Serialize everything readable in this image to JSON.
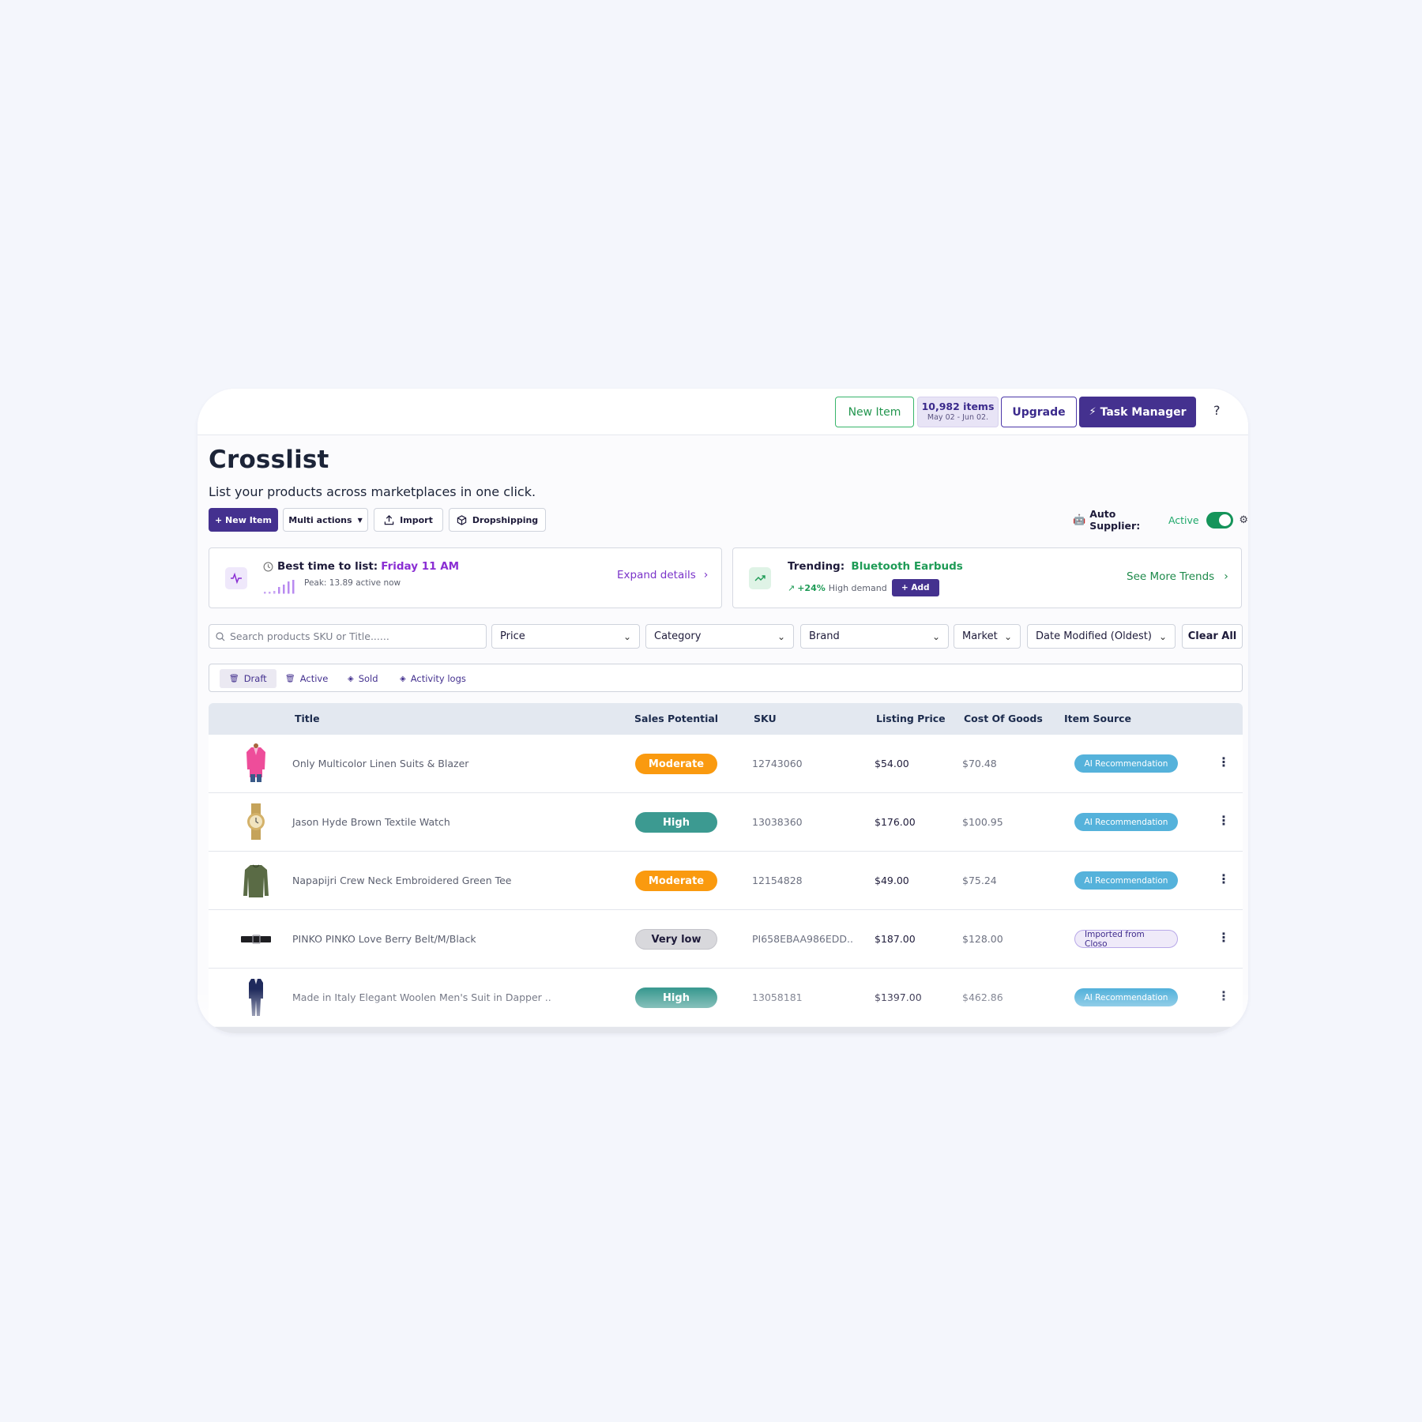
{
  "topbar": {
    "new_item": "New Item",
    "items_count": "10,982 items",
    "items_range": "May 02 - Jun 02.",
    "upgrade": "Upgrade",
    "task_manager": "Task Manager",
    "help": "?"
  },
  "page": {
    "title": "Crosslist",
    "subtitle": "List your products across marketplaces in one click."
  },
  "actions": {
    "new_item": "+ New Item",
    "multi_actions": "Multi actions",
    "import": "Import",
    "dropshipping": "Dropshipping"
  },
  "auto_supplier": {
    "label": "Auto Supplier:",
    "status": "Active",
    "enabled": true
  },
  "insights": {
    "best_time_label": "Best time to list:",
    "best_time_value": "Friday 11 AM",
    "peak": "Peak: 13.89 active now",
    "expand": "Expand details",
    "trending_label": "Trending:",
    "trending_value": "Bluetooth Earbuds",
    "trending_pct": "+24%",
    "trending_demand": "High demand",
    "trending_add": "+ Add",
    "see_more": "See More Trends"
  },
  "filters": {
    "search_placeholder": "Search products SKU or Title......",
    "price": "Price",
    "category": "Category",
    "brand": "Brand",
    "market": "Market",
    "date": "Date Modified (Oldest)",
    "clear": "Clear All"
  },
  "tabs": {
    "draft": "Draft",
    "active": "Active",
    "sold": "Sold",
    "logs": "Activity logs"
  },
  "table": {
    "headers": {
      "title": "Title",
      "potential": "Sales Potential",
      "sku": "SKU",
      "price": "Listing Price",
      "cost": "Cost Of Goods",
      "source": "Item Source"
    },
    "rows": [
      {
        "title": "Only Multicolor Linen Suits & Blazer",
        "potential": "Moderate",
        "sku": "12743060",
        "price": "$54.00",
        "cost": "$70.48",
        "source": "AI Recommendation",
        "image": "pink-blazer"
      },
      {
        "title": "Jason Hyde Brown Textile Watch",
        "potential": "High",
        "sku": "13038360",
        "price": "$176.00",
        "cost": "$100.95",
        "source": "AI Recommendation",
        "image": "gold-watch"
      },
      {
        "title": "Napapijri Crew Neck Embroidered Green Tee",
        "potential": "Moderate",
        "sku": "12154828",
        "price": "$49.00",
        "cost": "$75.24",
        "source": "AI Recommendation",
        "image": "green-tee"
      },
      {
        "title": "PINKO PINKO Love Berry Belt/M/Black",
        "potential": "Very low",
        "sku": "PI658EBAA986EDD..",
        "price": "$187.00",
        "cost": "$128.00",
        "source": "Imported from Closo",
        "image": "black-belt"
      },
      {
        "title": "Made in Italy Elegant Woolen Men's Suit in Dapper ..",
        "potential": "High",
        "sku": "13058181",
        "price": "$1397.00",
        "cost": "$462.86",
        "source": "AI Recommendation",
        "image": "navy-suit"
      }
    ]
  },
  "colors": {
    "brand_purple": "#44318f",
    "accent_green": "#1e9b56",
    "moderate": "#fa9a0f",
    "high": "#3c9a91",
    "ai_source": "#55b2db"
  }
}
